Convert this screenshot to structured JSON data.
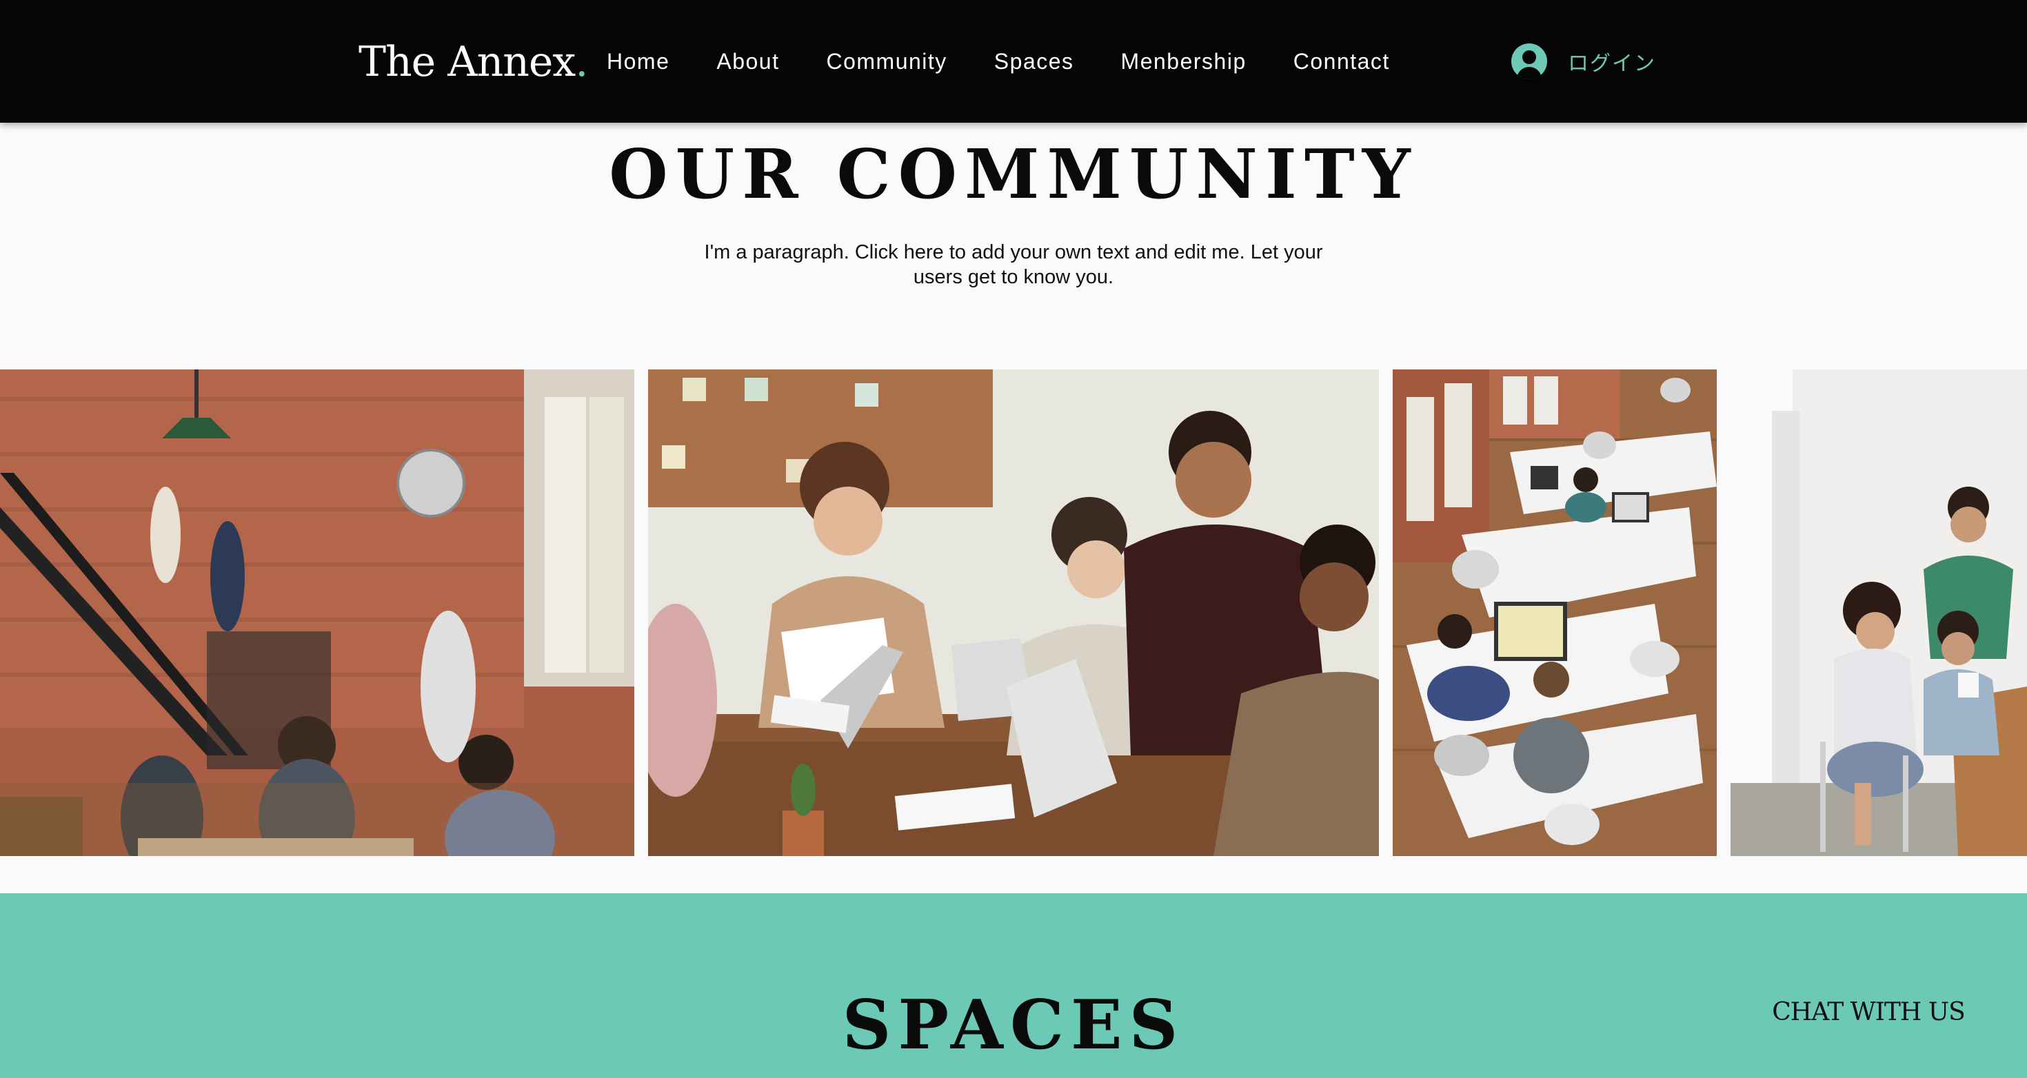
{
  "header": {
    "logo": "The Annex",
    "logo_dot": ".",
    "nav": [
      {
        "label": "Home"
      },
      {
        "label": "About"
      },
      {
        "label": "Community"
      },
      {
        "label": "Spaces"
      },
      {
        "label": "Menbership"
      },
      {
        "label": "Conntact"
      }
    ],
    "login_label": "ログイン",
    "login_icon": "user-avatar-icon"
  },
  "community": {
    "title": "OUR COMMUNITY",
    "paragraph": "I'm a paragraph. Click here to add your own text and edit me. Let your users get to know you."
  },
  "gallery": {
    "images": [
      {
        "name": "office-staircase-photo"
      },
      {
        "name": "team-meeting-photo"
      },
      {
        "name": "open-office-overhead-photo"
      },
      {
        "name": "coworkers-desk-photo"
      }
    ]
  },
  "spaces": {
    "title": "SPACES"
  },
  "chat": {
    "label": "CHAT WITH US"
  },
  "colors": {
    "header_bg": "#050505",
    "accent": "#6cc9b5",
    "page_bg": "#fafafa",
    "text": "#0a0a0a"
  }
}
